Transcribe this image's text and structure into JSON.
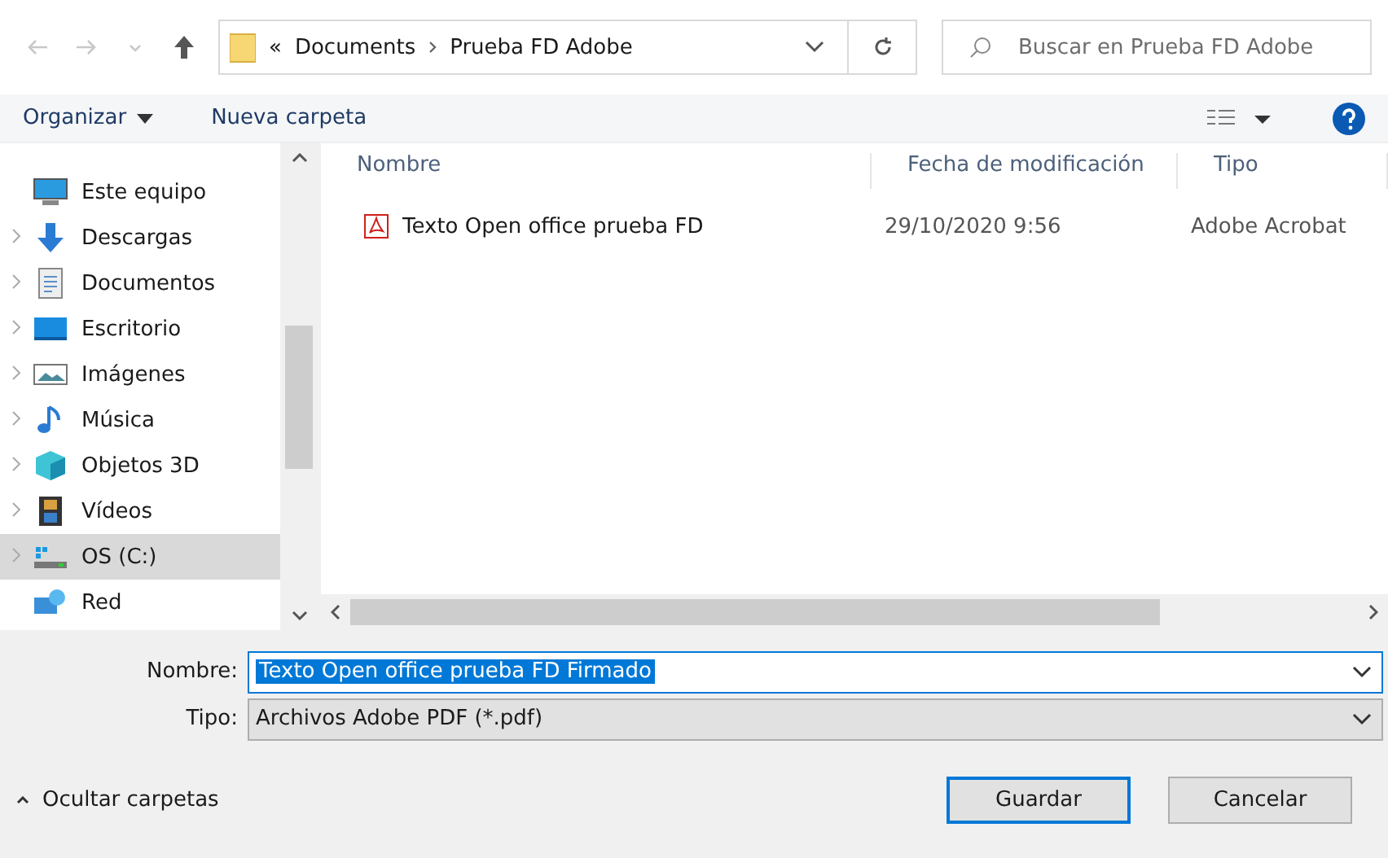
{
  "address_bar": {
    "overflow": "«",
    "path": [
      "Documents",
      "Prueba FD Adobe"
    ]
  },
  "search": {
    "placeholder": "Buscar en Prueba FD Adobe"
  },
  "toolbar": {
    "organize": "Organizar",
    "new_folder": "Nueva carpeta"
  },
  "sidebar": {
    "items": [
      {
        "label": "Este equipo",
        "kind": "computer",
        "expandable": false,
        "selected": false
      },
      {
        "label": "Descargas",
        "kind": "download",
        "expandable": true,
        "selected": false
      },
      {
        "label": "Documentos",
        "kind": "document",
        "expandable": true,
        "selected": false
      },
      {
        "label": "Escritorio",
        "kind": "desktop",
        "expandable": true,
        "selected": false
      },
      {
        "label": "Imágenes",
        "kind": "picture",
        "expandable": true,
        "selected": false
      },
      {
        "label": "Música",
        "kind": "music",
        "expandable": true,
        "selected": false
      },
      {
        "label": "Objetos 3D",
        "kind": "cube",
        "expandable": true,
        "selected": false
      },
      {
        "label": "Vídeos",
        "kind": "film",
        "expandable": true,
        "selected": false
      },
      {
        "label": "OS (C:)",
        "kind": "drive",
        "expandable": true,
        "selected": true
      },
      {
        "label": "Red",
        "kind": "network",
        "expandable": false,
        "selected": false
      }
    ]
  },
  "table": {
    "columns": [
      "Nombre",
      "Fecha de modificación",
      "Tipo"
    ],
    "rows": [
      {
        "name": "Texto Open office prueba FD",
        "date": "29/10/2020 9:56",
        "type": "Adobe Acrobat"
      }
    ]
  },
  "form": {
    "name_label": "Nombre:",
    "name_value": "Texto Open office prueba FD Firmado",
    "name_text_selected": true,
    "type_label": "Tipo:",
    "type_value": "Archivos Adobe PDF (*.pdf)"
  },
  "footer": {
    "hide_folders": "Ocultar carpetas",
    "buttons": [
      {
        "label": "Guardar",
        "default": true
      },
      {
        "label": "Cancelar",
        "default": false
      }
    ]
  }
}
